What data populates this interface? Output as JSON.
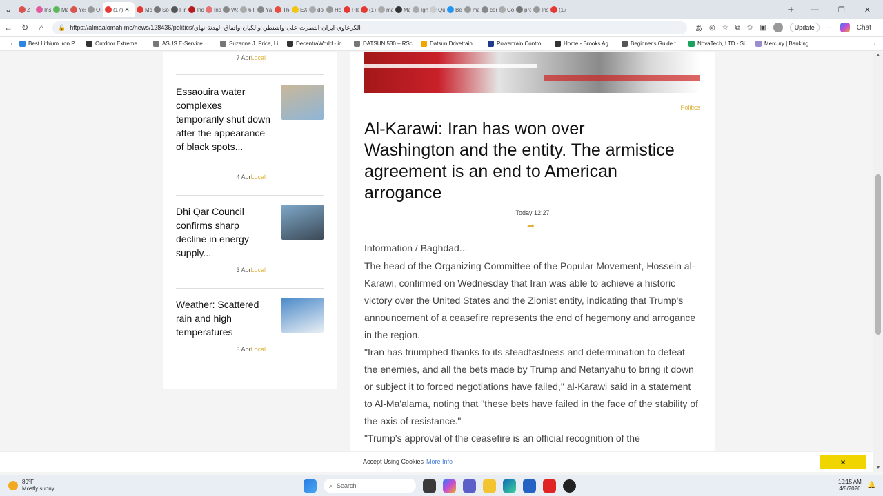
{
  "browser": {
    "tabs": [
      {
        "label": "Z",
        "color": "#d9534f"
      },
      {
        "label": "Ins",
        "color": "#e05a9d"
      },
      {
        "label": "Ma",
        "color": "#5cb85c"
      },
      {
        "label": "Yes",
        "color": "#d9534f"
      },
      {
        "label": "OR",
        "color": "#999999"
      },
      {
        "label": "(17)",
        "color": "#e53935",
        "active": true
      },
      {
        "label": "Mc",
        "color": "#e53935"
      },
      {
        "label": "Sou",
        "color": "#777777"
      },
      {
        "label": "Fina",
        "color": "#555555"
      },
      {
        "label": "Indi",
        "color": "#b71c1c"
      },
      {
        "label": "Ind",
        "color": "#e57373"
      },
      {
        "label": "Wal",
        "color": "#888888"
      },
      {
        "label": "6 P",
        "color": "#aaaaaa"
      },
      {
        "label": "Yah",
        "color": "#888888"
      },
      {
        "label": "The",
        "color": "#e74c3c"
      },
      {
        "label": "EXC",
        "color": "#f1c40f"
      },
      {
        "label": "dov",
        "color": "#aaaaaa"
      },
      {
        "label": "Hov",
        "color": "#999999"
      },
      {
        "label": "Ple",
        "color": "#e53935"
      },
      {
        "label": "(17)",
        "color": "#e53935"
      },
      {
        "label": "ma",
        "color": "#aaaaaa"
      },
      {
        "label": "Mai",
        "color": "#333333"
      },
      {
        "label": "Ign",
        "color": "#aaaaaa"
      },
      {
        "label": "Qu",
        "color": "#cccccc"
      },
      {
        "label": "Bes",
        "color": "#2196f3"
      },
      {
        "label": "ma",
        "color": "#999999"
      },
      {
        "label": "con",
        "color": "#888888"
      },
      {
        "label": "Con",
        "color": "#aaaaaa"
      },
      {
        "label": "prof",
        "color": "#777777"
      },
      {
        "label": "Ins",
        "color": "#999999"
      },
      {
        "label": "(17)",
        "color": "#e53935"
      }
    ],
    "url": "https://almaalomah.me/news/128436/politics/الكرعاوي-ايران-انتصرت-على-واشنطن-والكيان-واتفاق-الهدنة-نهاي",
    "update_label": "Update",
    "chat_label": "Chat",
    "bookmarks": [
      {
        "label": "Best Lithium Iron P...",
        "color": "#2e86de"
      },
      {
        "label": "Outdoor Extreme...",
        "color": "#333333"
      },
      {
        "label": "ASUS E-Service",
        "color": "#777777"
      },
      {
        "label": "Suzanne J. Price, Li...",
        "color": "#777777"
      },
      {
        "label": "DecentraWorld - in...",
        "color": "#333333"
      },
      {
        "label": "DATSUN 530 – RSc...",
        "color": "#777777"
      },
      {
        "label": "Datsun Drivetrain",
        "color": "#f0a500"
      },
      {
        "label": "Powertrain Control...",
        "color": "#1e3c8c"
      },
      {
        "label": "Home - Brooks Ag...",
        "color": "#333333"
      },
      {
        "label": "Beginner's Guide t...",
        "color": "#555555"
      },
      {
        "label": "NovaTech, LTD - Si...",
        "color": "#1aa35c"
      },
      {
        "label": "Mercury | Banking...",
        "color": "#9b8ccf"
      }
    ]
  },
  "sidebar": {
    "top_meta": {
      "date": "7 Apr",
      "category": "Local"
    },
    "items": [
      {
        "title": "Essaouira water complexes temporarily shut down after the appearance of black spots...",
        "date": "4 Apr",
        "category": "Local",
        "thumb": [
          "#c9b79a",
          "#8fb6d6"
        ]
      },
      {
        "title": "Dhi Qar Council confirms sharp decline in energy supply...",
        "date": "3 Apr",
        "category": "Local",
        "thumb": [
          "#7ea8c9",
          "#3c4a57"
        ]
      },
      {
        "title": "Weather: Scattered rain and high temperatures",
        "date": "3 Apr",
        "category": "Local",
        "thumb": [
          "#4a89c8",
          "#e8eef4"
        ]
      }
    ]
  },
  "article": {
    "category": "Politics",
    "title": "Al-Karawi: Iran has won over Washington and the entity. The armistice agreement is an end to American arrogance",
    "time": "Today 12:27",
    "share_icon": "share-arrow-icon",
    "paragraphs": [
      "Information / Baghdad...",
      "The head of the Organizing Committee of the Popular Movement, Hossein al-Karawi, confirmed on Wednesday that Iran was able to achieve a historic victory over the United States and the Zionist entity, indicating that Trump's announcement of a ceasefire represents the end of hegemony and arrogance in the region.",
      "\"Iran has triumphed thanks to its steadfastness and determination to defeat the enemies, and all the bets made by Trump and Netanyahu to bring it down or subject it to forced negotiations have failed,\" al-Karawi said in a statement to Al-Ma'alama, noting that \"these bets have failed in the face of the stability of the axis of resistance.\"",
      "\"Trump's approval of the ceasefire is an official recognition of the"
    ]
  },
  "cookie": {
    "text": "Accept Using Cookies",
    "more": "More Info",
    "close": "×"
  },
  "taskbar": {
    "temp": "80°F",
    "condition": "Mostly sunny",
    "search_placeholder": "Search",
    "time": "10:15 AM",
    "date": "4/8/2026"
  }
}
